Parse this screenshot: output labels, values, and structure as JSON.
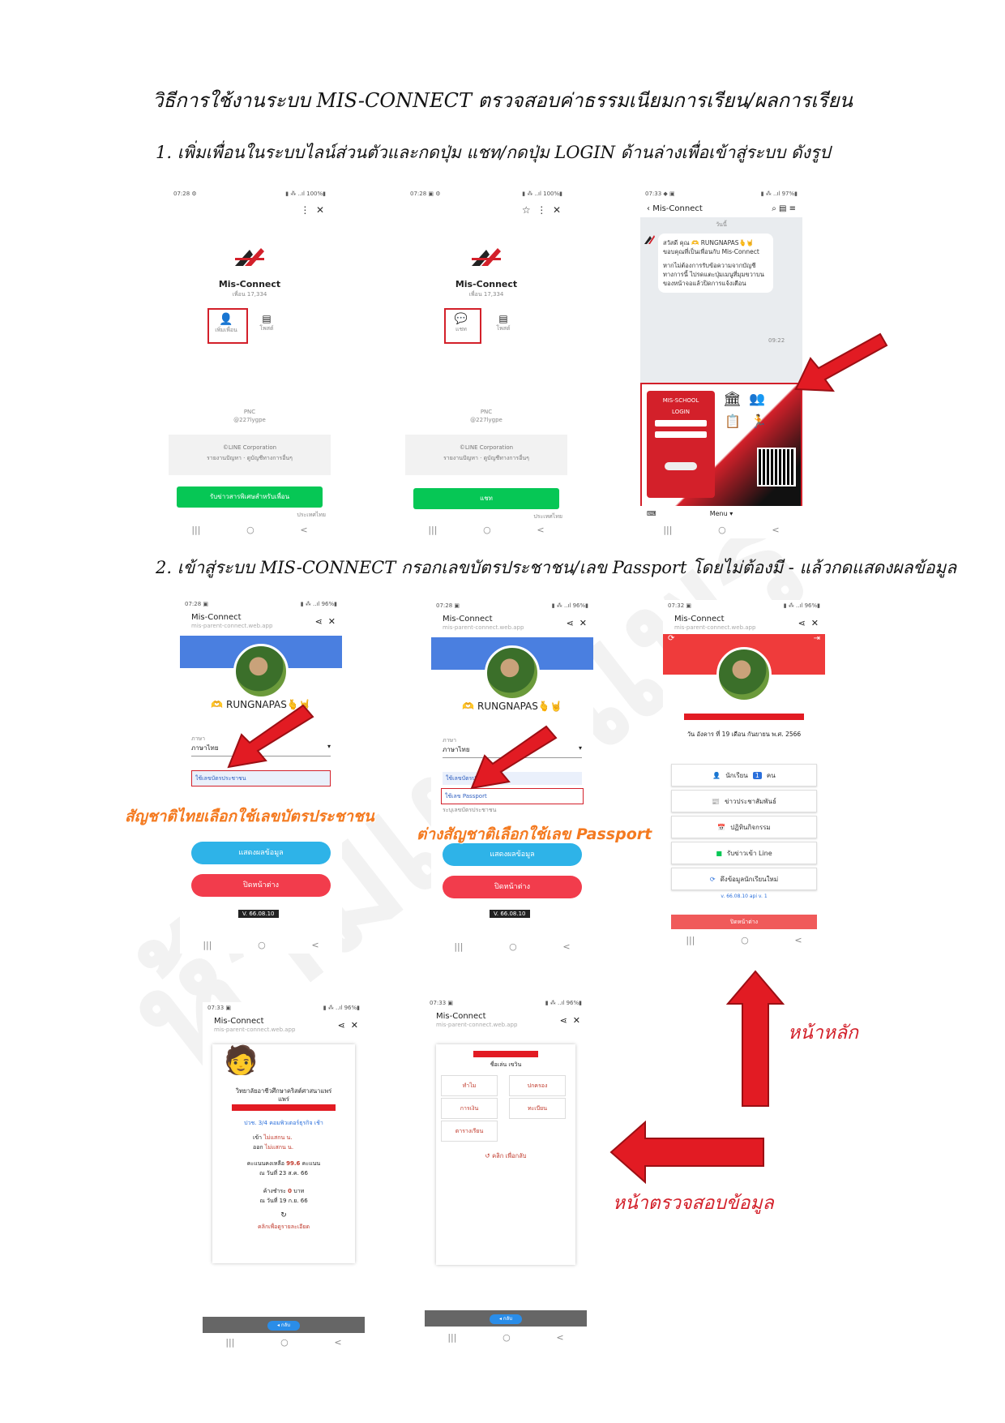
{
  "doc": {
    "title": "วิธีการใช้งานระบบ MIS-CONNECT ตรวจสอบค่าธรรมเนียมการเรียน/ผลการเรียน",
    "step1": "1.   เพิ่มเพื่อนในระบบไลน์ส่วนตัวและกดปุ่ม แชท/กดปุ่ม LOGIN ด้านล่างเพื่อเข้าสู่ระบบ ดังรูป",
    "step2": "2.   เข้าสู่ระบบ MIS-CONNECT กรอกเลขบัตรประชาชน/เลข Passport โดยไม่ต้องมี - แล้วกดแสดงผลข้อมูล",
    "caption_thai": "สัญชาติไทยเลือกใช้เลขบัตรประชาชน",
    "caption_foreign": "ต่างสัญชาติเลือกใช้เลข Passport",
    "caption_home": "หน้าหลัก",
    "caption_check": "หน้าตรวจสอบข้อมูล",
    "watermark": "ห้ามเผยแพร่"
  },
  "line_profile": {
    "name": "Mis-Connect",
    "friends": "เพื่อน 17,334",
    "add_friend": "เพิ่มเพื่อน",
    "chat": "แชท",
    "post": "โพสต์",
    "pnc": "PNC",
    "id": "@227lygpe",
    "corp": "©LINE Corporation",
    "terms": "รายงานปัญหา · ดูบัญชีทางการอื่นๆ",
    "green_btn_1": "รับข่าวสารพิเศษสำหรับเพื่อน",
    "green_btn_2": "แชท",
    "lang": "ประเทศไทย"
  },
  "chat_screen": {
    "header": "Mis-Connect",
    "day": "วันนี้",
    "msg_line1": "สวัสดี คุณ 🫶 RUNGNAPAS🫰🤘",
    "msg_line2": "ขอบคุณที่เป็นเพื่อนกับ Mis-Connect",
    "msg_line3": "หากไม่ต้องการรับข้อความจากบัญชีทางการนี้ ไปรดแตะปุ่มเมนูที่มุมขวาบนของหน้าจอแล้วปิดการแจ้งเตือน",
    "time": "09:22",
    "school": "MIS-SCHOOL",
    "login": "LOGIN",
    "menu": "Menu ▾"
  },
  "webapp": {
    "title": "Mis-Connect",
    "url": "mis-parent-connect.web.app",
    "user": "🫶 RUNGNAPAS🫰🤘",
    "lang_label": "ภาษา",
    "lang_value": "ภาษาไทย",
    "opt_id": "ใช้เลขบัตรประชาชน",
    "opt_passport": "ใช้เลข Passport",
    "opt_other": "ระบุเลขบัตรประชาชน",
    "show_btn": "แสดงผลข้อมูล",
    "close_btn": "ปิดหน้าต่าง",
    "version": "V. 66.08.10"
  },
  "home_screen": {
    "date": "วัน อังคาร ที่ 19 เดือน กันยายน พ.ศ. 2566",
    "students": "นักเรียน",
    "count": "1",
    "unit": "คน",
    "news": "ข่าวประชาสัมพันธ์",
    "calendar": "ปฏิทินกิจกรรม",
    "line_news": "รับข่าวเข้า Line",
    "reload": "ดึงข้อมูลนักเรียนใหม่",
    "version": "v. 66.08.10 api v. 1",
    "close": "ปิดหน้าต่าง"
  },
  "detail_screen": {
    "college": "วิทยาลัยอาชีวศึกษาคริสต์ศาสนาแพร่",
    "college2": "แพร่",
    "class": "ปวช. 3/4 คอมพิวเตอร์ธุรกิจ เช้า",
    "in": "เข้า",
    "out": "ออก",
    "in_val": "ไม่แสกน น.",
    "out_val": "ไม่แสกน น.",
    "score_label": "คะแนนคงเหลือ",
    "score": "99.6",
    "score_unit": "คะแนน",
    "score_date": "ณ วันที่ 23 ส.ค. 66",
    "owe_label": "ค้างชำระ",
    "owe": "0",
    "owe_unit": "บาท",
    "owe_date": "ณ วันที่ 19 ก.ย. 66",
    "detail_link": "คลิกเพื่อดูรายละเอียด",
    "back": "◂ กลับ"
  },
  "menu_screen": {
    "heading": "ชื่อเล่น เขวิน",
    "t1": "ทำไม",
    "t2": "ปกครอง",
    "t3": "การเงิน",
    "t4": "ทะเบียน",
    "t5": "ตารางเรียน",
    "back_link": "คลิก เพื่อกลับ",
    "back": "◂ กลับ"
  },
  "colors": {
    "accent_red": "#d3202a",
    "caption_orange": "#f47a20",
    "line_green": "#06c755",
    "blue_header": "#4a7fe0",
    "red_header": "#ef3b3b",
    "btn_blue": "#2eb3e8",
    "btn_red": "#f23c4c"
  }
}
